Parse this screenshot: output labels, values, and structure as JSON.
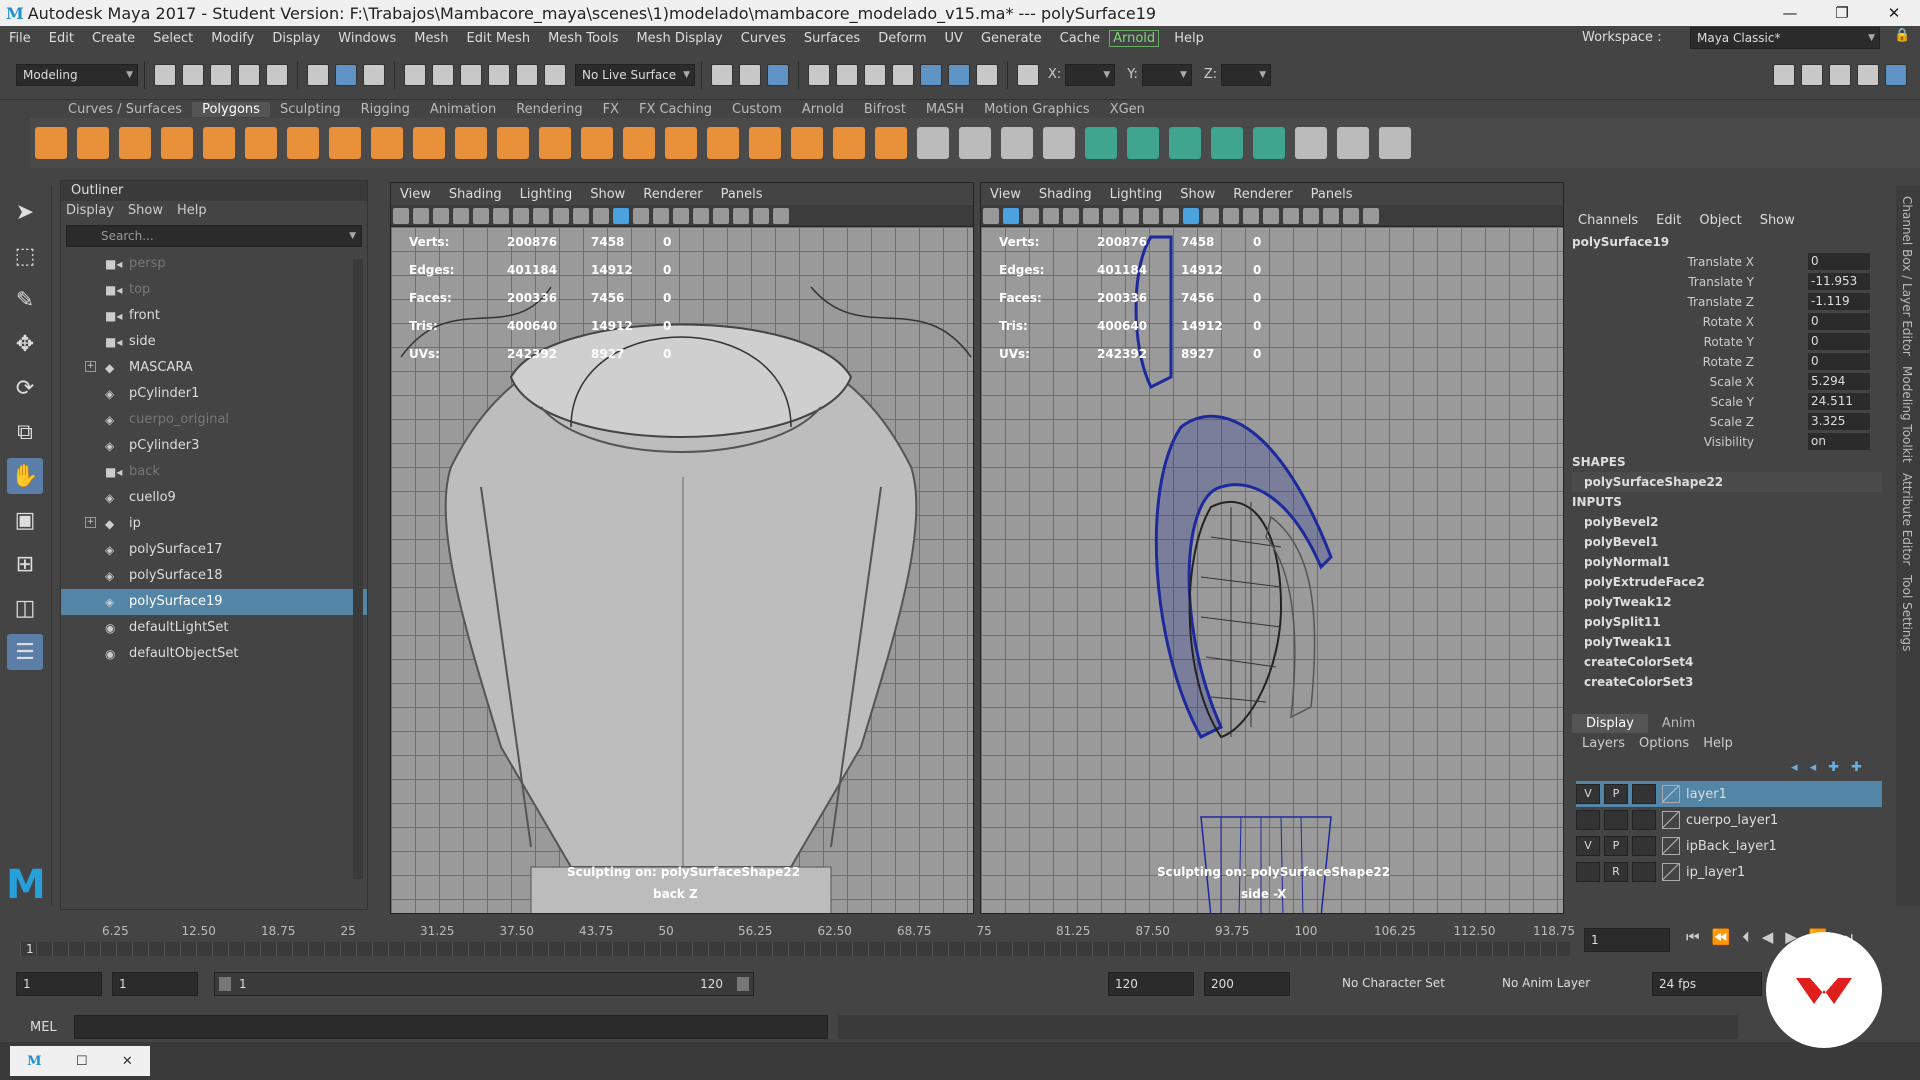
{
  "window": {
    "title": "Autodesk Maya 2017 - Student Version: F:\\Trabajos\\Mambacore_maya\\scenes\\1)modelado\\mambacore_modelado_v15.ma*   ---   polySurface19",
    "app_icon": "M"
  },
  "menubar": {
    "items": [
      "File",
      "Edit",
      "Create",
      "Select",
      "Modify",
      "Display",
      "Windows",
      "Mesh",
      "Edit Mesh",
      "Mesh Tools",
      "Mesh Display",
      "Curves",
      "Surfaces",
      "Deform",
      "UV",
      "Generate",
      "Cache"
    ],
    "arnold": "Arnold",
    "help": "Help",
    "workspace_label": "Workspace :",
    "workspace_value": "Maya Classic*"
  },
  "statusline": {
    "mode": "Modeling",
    "live_surface": "No Live Surface",
    "x_label": "X:",
    "y_label": "Y:",
    "z_label": "Z:"
  },
  "shelf": {
    "tabs": [
      "Curves / Surfaces",
      "Polygons",
      "Sculpting",
      "Rigging",
      "Animation",
      "Rendering",
      "FX",
      "FX Caching",
      "Custom",
      "Arnold",
      "Bifrost",
      "MASH",
      "Motion Graphics",
      "XGen"
    ],
    "active_tab": "Polygons"
  },
  "outliner": {
    "title": "Outliner",
    "menu": [
      "Display",
      "Show",
      "Help"
    ],
    "search_placeholder": "Search...",
    "items": [
      {
        "label": "persp",
        "icon": "camera",
        "dim": true
      },
      {
        "label": "top",
        "icon": "camera",
        "dim": true
      },
      {
        "label": "front",
        "icon": "camera",
        "dim": false
      },
      {
        "label": "side",
        "icon": "camera",
        "dim": false
      },
      {
        "label": "MASCARA",
        "icon": "group",
        "dim": false,
        "expand": true
      },
      {
        "label": "pCylinder1",
        "icon": "mesh",
        "dim": false
      },
      {
        "label": "cuerpo_original",
        "icon": "mesh",
        "dim": true
      },
      {
        "label": "pCylinder3",
        "icon": "mesh",
        "dim": false
      },
      {
        "label": "back",
        "icon": "camera",
        "dim": true
      },
      {
        "label": "cuello9",
        "icon": "mesh",
        "dim": false
      },
      {
        "label": "ip",
        "icon": "group",
        "dim": false,
        "expand": true
      },
      {
        "label": "polySurface17",
        "icon": "mesh",
        "dim": false
      },
      {
        "label": "polySurface18",
        "icon": "mesh",
        "dim": false
      },
      {
        "label": "polySurface19",
        "icon": "mesh",
        "dim": false,
        "selected": true
      },
      {
        "label": "defaultLightSet",
        "icon": "set",
        "dim": false
      },
      {
        "label": "defaultObjectSet",
        "icon": "set",
        "dim": false
      }
    ]
  },
  "viewport_menu": [
    "View",
    "Shading",
    "Lighting",
    "Show",
    "Renderer",
    "Panels"
  ],
  "hud": {
    "rows": [
      {
        "label": "Verts:",
        "a": "200876",
        "b": "7458",
        "c": "0"
      },
      {
        "label": "Edges:",
        "a": "401184",
        "b": "14912",
        "c": "0"
      },
      {
        "label": "Faces:",
        "a": "200336",
        "b": "7456",
        "c": "0"
      },
      {
        "label": "Tris:",
        "a": "400640",
        "b": "14912",
        "c": "0"
      },
      {
        "label": "UVs:",
        "a": "242392",
        "b": "8927",
        "c": "0"
      }
    ]
  },
  "viewport_left": {
    "sculpt": "Sculpting on: polySurfaceShape22",
    "camera": "back Z"
  },
  "viewport_right": {
    "sculpt": "Sculpting on: polySurfaceShape22",
    "camera": "side -X"
  },
  "channelbox": {
    "menu": [
      "Channels",
      "Edit",
      "Object",
      "Show"
    ],
    "object": "polySurface19",
    "attributes": [
      {
        "name": "Translate X",
        "value": "0"
      },
      {
        "name": "Translate Y",
        "value": "-11.953"
      },
      {
        "name": "Translate Z",
        "value": "-1.119"
      },
      {
        "name": "Rotate X",
        "value": "0"
      },
      {
        "name": "Rotate Y",
        "value": "0"
      },
      {
        "name": "Rotate Z",
        "value": "0"
      },
      {
        "name": "Scale X",
        "value": "5.294"
      },
      {
        "name": "Scale Y",
        "value": "24.511"
      },
      {
        "name": "Scale Z",
        "value": "3.325"
      },
      {
        "name": "Visibility",
        "value": "on"
      }
    ],
    "shapes_label": "SHAPES",
    "shape": "polySurfaceShape22",
    "inputs_label": "INPUTS",
    "inputs": [
      "polyBevel2",
      "polyBevel1",
      "polyNormal1",
      "polyExtrudeFace2",
      "polyTweak12",
      "polySplit11",
      "polyTweak11",
      "createColorSet4",
      "createColorSet3"
    ]
  },
  "layers": {
    "tabs": [
      "Display",
      "Anim"
    ],
    "menu": [
      "Layers",
      "Options",
      "Help"
    ],
    "rows": [
      {
        "v": "V",
        "p": "P",
        "name": "layer1",
        "selected": true
      },
      {
        "v": "",
        "p": "",
        "name": "cuerpo_layer1",
        "selected": false
      },
      {
        "v": "V",
        "p": "P",
        "name": "ipBack_layer1",
        "selected": false
      },
      {
        "v": "",
        "p": "R",
        "name": "ip_layer1",
        "selected": false
      }
    ]
  },
  "sidetabs": [
    "Channel Box / Layer Editor",
    "Modeling Toolkit",
    "Attribute Editor",
    "Tool Settings"
  ],
  "timeslider": {
    "ticks": [
      "6.25",
      "12.50",
      "18.75",
      "25",
      "31.25",
      "37.50",
      "43.75",
      "50",
      "56.25",
      "62.50",
      "68.75",
      "75",
      "81.25",
      "87.50",
      "93.75",
      "100",
      "106.25",
      "112.50",
      "118.75"
    ],
    "current_frame_marker": "1",
    "current_frame": "1"
  },
  "range": {
    "start": "1",
    "playback_start": "1",
    "slider_start": "1",
    "slider_end": "120",
    "playback_end": "120",
    "end": "200",
    "character_set": "No Character Set",
    "anim_layer": "No Anim Layer",
    "fps": "24 fps"
  },
  "cmdline": {
    "label": "MEL"
  }
}
